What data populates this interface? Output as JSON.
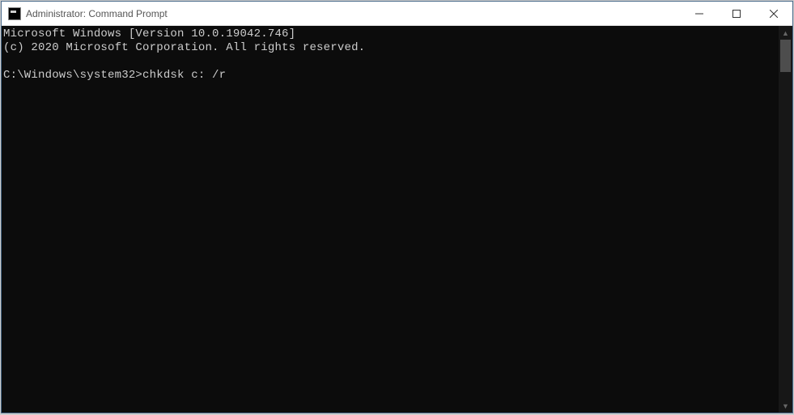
{
  "window": {
    "title": "Administrator: Command Prompt"
  },
  "terminal": {
    "line1": "Microsoft Windows [Version 10.0.19042.746]",
    "line2": "(c) 2020 Microsoft Corporation. All rights reserved.",
    "blank": "",
    "prompt": "C:\\Windows\\system32>",
    "command": "chkdsk c: /r"
  }
}
